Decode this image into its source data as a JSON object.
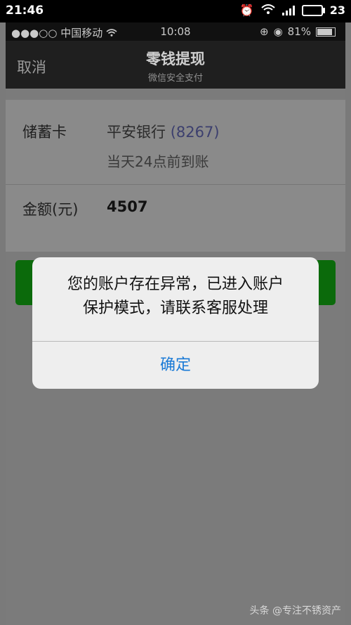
{
  "android_status": {
    "time": "21:46",
    "battery": "23"
  },
  "ios_status": {
    "carrier": "●●●○○ 中国移动",
    "time": "10:08",
    "battery": "81%"
  },
  "navbar": {
    "cancel": "取消",
    "title": "零钱提现",
    "subtitle": "微信安全支付"
  },
  "form": {
    "card_label": "储蓄卡",
    "bank_name": "平安银行",
    "bank_number": "(8267)",
    "arrival_note": "当天24点前到账",
    "amount_label": "金额(元)",
    "amount_value": "4507"
  },
  "dialog": {
    "line1": "您的账户存在异常，已进入账户",
    "line2": "保护模式，请联系客服处理",
    "confirm": "确定"
  },
  "watermark": "头条 @专注不锈资产",
  "colors": {
    "confirm_blue": "#1a7ad6",
    "button_green": "#0b6a0b"
  }
}
